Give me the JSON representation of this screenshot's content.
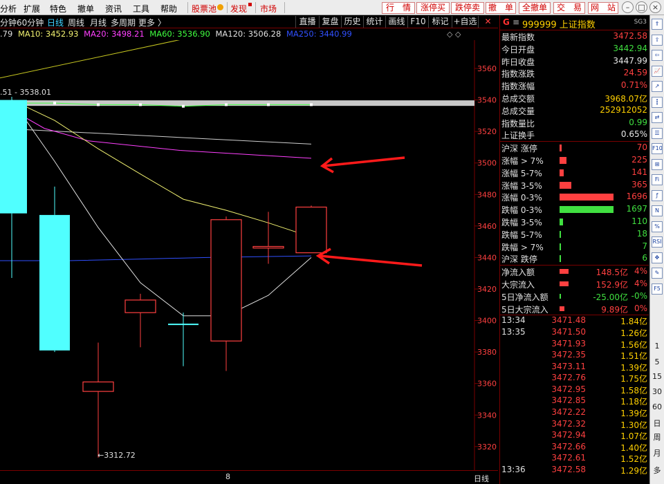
{
  "menu": {
    "items": [
      "分析",
      "扩展",
      "特色",
      "撤单",
      "资讯",
      "工具",
      "帮助"
    ],
    "stock_pool": "股票池",
    "discover": "发现",
    "market": "市场",
    "buttons": [
      "行　情",
      "涨停买",
      "跌停卖",
      "撤　单",
      "全撤单",
      "交　易",
      "网　站"
    ]
  },
  "toolbar": {
    "periods": [
      "分钟",
      "60分钟",
      "日线",
      "周线",
      "月线",
      "多周期",
      "更多 〉"
    ],
    "active_period": "日线",
    "buttons": [
      "直播",
      "复盘",
      "历史",
      "统计",
      "画线",
      "F10",
      "标记",
      "+自选"
    ]
  },
  "ma_legend": {
    "ma5": ".79",
    "ma10": "MA10: 3452.93",
    "ma20": "MA20: 3498.21",
    "ma60": "MA60: 3536.90",
    "ma120": "MA120: 3506.28",
    "ma250": "MA250: 3440.99",
    "colors": {
      "ma5": "#e0e0e0",
      "ma10": "#f0f070",
      "ma20": "#ff40ff",
      "ma60": "#40ff40",
      "ma120": "#e0e0e0",
      "ma250": "#3050ff"
    }
  },
  "chart": {
    "y_ticks": [
      "3560",
      "3540",
      "3520",
      "3500",
      "3480",
      "3460",
      "3440",
      "3420",
      "3400",
      "3380",
      "3360",
      "3340",
      "3320"
    ],
    "high_label": ".51 - 3538.01",
    "low_label": "←3312.72",
    "date_label": "8",
    "period_label": "日线",
    "up_color": "#ff4040",
    "down_color": "#50ffff",
    "arrow_color": "#ff1a1a"
  },
  "chart_data": {
    "type": "candlestick",
    "y_range": [
      3305,
      3578
    ],
    "candles": [
      {
        "open": 3540,
        "close": 3468,
        "high": 3542,
        "low": 3427,
        "dir": "down"
      },
      {
        "open": 3467,
        "close": 3381,
        "high": 3485,
        "low": 3380,
        "dir": "down"
      },
      {
        "open": 3355,
        "close": 3361,
        "high": 3386,
        "low": 3313,
        "dir": "up"
      },
      {
        "open": 3405,
        "close": 3413,
        "high": 3417,
        "low": 3383,
        "dir": "up"
      },
      {
        "open": 3398,
        "close": 3398,
        "high": 3405,
        "low": 3371,
        "dir": "down"
      },
      {
        "open": 3387,
        "close": 3464,
        "high": 3466,
        "low": 3368,
        "dir": "up"
      },
      {
        "open": 3446,
        "close": 3447,
        "high": 3469,
        "low": 3436,
        "dir": "up"
      },
      {
        "open": 3443,
        "close": 3472,
        "high": 3473,
        "low": 3443,
        "dir": "up"
      }
    ],
    "ma_lines": {
      "ma60": [
        3538,
        3538,
        3537,
        3537,
        3536,
        3537,
        3537,
        3537
      ],
      "ma10": [
        3540,
        3527,
        3509,
        3493,
        3477,
        3470,
        3462,
        3453
      ],
      "ma5": [
        3540,
        3501,
        3459,
        3424,
        3403,
        3403,
        3416,
        3440
      ],
      "ma20": [
        3538,
        3522,
        3514,
        3508,
        3503
      ],
      "ma250": [
        3438,
        3438,
        3439,
        3440,
        3441
      ]
    }
  },
  "panel": {
    "code": "999999",
    "name": "上证指数",
    "tag": "SG3",
    "quotes": [
      {
        "label": "最新指数",
        "value": "3472.58",
        "color": "red"
      },
      {
        "label": "今日开盘",
        "value": "3442.94",
        "color": "green"
      },
      {
        "label": "昨日收盘",
        "value": "3447.99",
        "color": "white"
      },
      {
        "label": "指数涨跌",
        "value": "24.59",
        "color": "red"
      },
      {
        "label": "指数涨幅",
        "value": "0.71%",
        "color": "red"
      },
      {
        "label": "总成交额",
        "value": "3968.07亿",
        "color": "yellow"
      },
      {
        "label": "总成交量",
        "value": "252912052",
        "color": "yellow"
      },
      {
        "label": "指数量比",
        "value": "0.99",
        "color": "green"
      },
      {
        "label": "上证换手",
        "value": "0.65%",
        "color": "white"
      }
    ],
    "distribution": [
      {
        "label": "沪深 涨停",
        "value": "70",
        "color": "red",
        "bar": 0.04
      },
      {
        "label": "涨幅 > 7%",
        "value": "225",
        "color": "red",
        "bar": 0.13
      },
      {
        "label": "涨幅 5-7%",
        "value": "141",
        "color": "red",
        "bar": 0.08
      },
      {
        "label": "涨幅 3-5%",
        "value": "365",
        "color": "red",
        "bar": 0.22
      },
      {
        "label": "涨幅 0-3%",
        "value": "1696",
        "color": "red",
        "bar": 1.0
      },
      {
        "label": "跌幅 0-3%",
        "value": "1697",
        "color": "green",
        "bar": 1.0
      },
      {
        "label": "跌幅 3-5%",
        "value": "110",
        "color": "green",
        "bar": 0.07
      },
      {
        "label": "跌幅 5-7%",
        "value": "18",
        "color": "green",
        "bar": 0.015
      },
      {
        "label": "跌幅 > 7%",
        "value": "7",
        "color": "green",
        "bar": 0.01
      },
      {
        "label": "沪深 跌停",
        "value": "6",
        "color": "green",
        "bar": 0.01
      }
    ],
    "flows": [
      {
        "label": "净流入额",
        "value": "148.5亿",
        "pct": "4%",
        "color": "red",
        "bar": 0.6
      },
      {
        "label": "大宗流入",
        "value": "152.9亿",
        "pct": "4%",
        "color": "red",
        "bar": 0.6
      },
      {
        "label": "5日净流入额",
        "value": "-25.00亿",
        "pct": "-0%",
        "color": "green",
        "bar": 0.1
      },
      {
        "label": "5日大宗流入",
        "value": "9.89亿",
        "pct": "0%",
        "color": "red",
        "bar": 0.3
      }
    ],
    "ticks": [
      {
        "time": "13:34",
        "price": "3471.48",
        "vol": "1.84亿"
      },
      {
        "time": "13:35",
        "price": "3471.50",
        "vol": "1.26亿"
      },
      {
        "time": "",
        "price": "3471.93",
        "vol": "1.56亿"
      },
      {
        "time": "",
        "price": "3472.35",
        "vol": "1.51亿"
      },
      {
        "time": "",
        "price": "3473.11",
        "vol": "1.39亿"
      },
      {
        "time": "",
        "price": "3472.76",
        "vol": "1.75亿"
      },
      {
        "time": "",
        "price": "3472.95",
        "vol": "1.58亿"
      },
      {
        "time": "",
        "price": "3472.85",
        "vol": "1.18亿"
      },
      {
        "time": "",
        "price": "3472.22",
        "vol": "1.39亿"
      },
      {
        "time": "",
        "price": "3472.32",
        "vol": "1.30亿"
      },
      {
        "time": "",
        "price": "3472.94",
        "vol": "1.07亿"
      },
      {
        "time": "",
        "price": "3472.66",
        "vol": "1.40亿"
      },
      {
        "time": "",
        "price": "3472.61",
        "vol": "1.52亿"
      },
      {
        "time": "13:36",
        "price": "3472.58",
        "vol": "1.29亿"
      }
    ]
  },
  "strip": {
    "periods": [
      "1",
      "5",
      "15",
      "30",
      "60",
      "日",
      "周",
      "月",
      "多"
    ]
  }
}
